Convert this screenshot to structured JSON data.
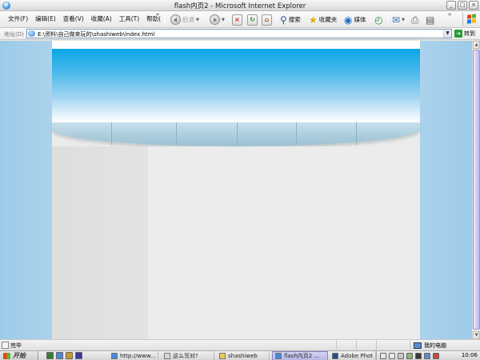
{
  "window": {
    "title": "flash内页2 - Microsoft Internet Explorer",
    "controls": [
      "_",
      "□",
      "×"
    ]
  },
  "menu": [
    "文件(F)",
    "编辑(E)",
    "查看(V)",
    "收藏(A)",
    "工具(T)",
    "帮助("
  ],
  "toolbar": {
    "overflow": "»",
    "back_label": "后退",
    "search_label": "搜索",
    "favorites_label": "收藏夹",
    "media_label": "媒体"
  },
  "address": {
    "label": "地址(D)",
    "url": "E:\\资料\\自己做来玩的\\shashiweb\\index.html",
    "go_label": "转到"
  },
  "status": {
    "text": "完毕",
    "zone": "我的电脑"
  },
  "taskbar": {
    "start_label": "开始",
    "tasks": [
      "http://www...",
      "这么写对?",
      "shashiweb",
      "flash内页2 ...",
      "Adobe Phot"
    ],
    "active_task": "flash内页2 ...",
    "clock": "10:06"
  },
  "colors": {
    "banner_top": "#09a6e6",
    "side_background": "#a7cde8",
    "page_background": "#ebebeb",
    "nav_strip": "#a9cbdb"
  }
}
